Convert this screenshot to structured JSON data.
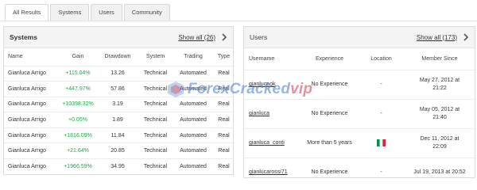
{
  "tabs": [
    {
      "label": "All Results",
      "active": true
    },
    {
      "label": "Systems",
      "active": false
    },
    {
      "label": "Users",
      "active": false
    },
    {
      "label": "Community",
      "active": false
    }
  ],
  "systems": {
    "title": "Systems",
    "show_all": "Show all (26)",
    "columns": [
      "Name",
      "Gain",
      "Drawdown",
      "System",
      "Trading",
      "Type"
    ],
    "rows": [
      {
        "name": "Gianluca Arrigo",
        "gain": "+115.04%",
        "drawdown": "13.26",
        "system": "Technical",
        "trading": "Automated",
        "type": "Real"
      },
      {
        "name": "Gianluca Arrigo",
        "gain": "+447.97%",
        "drawdown": "57.86",
        "system": "Technical",
        "trading": "Automated",
        "type": "Real"
      },
      {
        "name": "Gianluca Arrigo",
        "gain": "+10398.32%",
        "drawdown": "3.19",
        "system": "Technical",
        "trading": "Automated",
        "type": "Real"
      },
      {
        "name": "Gianluca Arrigo",
        "gain": "+0.05%",
        "drawdown": "1.89",
        "system": "Technical",
        "trading": "Automated",
        "type": "Real"
      },
      {
        "name": "Gianluca Arrigo",
        "gain": "+1816.09%",
        "drawdown": "11.84",
        "system": "Technical",
        "trading": "Automated",
        "type": "Real"
      },
      {
        "name": "Gianluca Arrigo",
        "gain": "+21.64%",
        "drawdown": "20.85",
        "system": "Technical",
        "trading": "Automated",
        "type": "Real"
      },
      {
        "name": "Gianluca Arrigo",
        "gain": "+1966.59%",
        "drawdown": "34.95",
        "system": "Technical",
        "trading": "Automated",
        "type": "Real"
      }
    ]
  },
  "users": {
    "title": "Users",
    "show_all": "Show all (173)",
    "columns": [
      "Username",
      "Experience",
      "Location",
      "Member Since"
    ],
    "rows": [
      {
        "username": "gianlucaok",
        "experience": "No Experience",
        "location": "-",
        "since_date": "May 27, 2012 at",
        "since_time": "21:22"
      },
      {
        "username": "gianluca",
        "experience": "No Experience",
        "location": "-",
        "since_date": "May 05, 2012 at",
        "since_time": "21:40"
      },
      {
        "username": "gianluca_conti",
        "experience": "More than 5 years",
        "location": "",
        "location_icon": "italy-flag-icon",
        "since_date": "Dec 11, 2012 at",
        "since_time": "22:09"
      },
      {
        "username": "gianlucarossi71",
        "experience": "No Experience",
        "location": "-",
        "since_date": "Jul 19, 2013 at 20:52",
        "since_time": ""
      }
    ]
  },
  "watermark": {
    "part1": "ForexCracked",
    "part2": "vip"
  },
  "colors": {
    "gain": "#22a74a",
    "italy_green": "#009246",
    "italy_red": "#ce2b37"
  }
}
